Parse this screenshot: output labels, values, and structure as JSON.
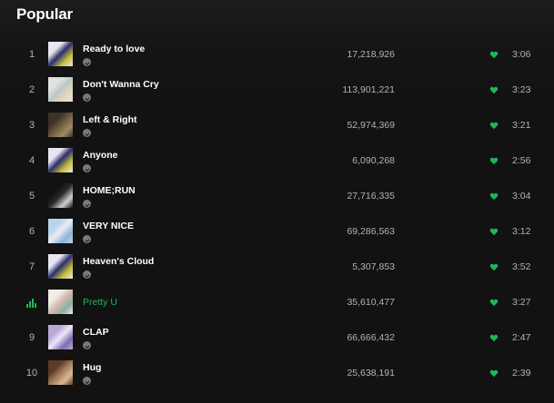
{
  "section": {
    "title": "Popular"
  },
  "colors": {
    "accent": "#1db954",
    "muted": "#b3b3b3",
    "background": "#121212"
  },
  "tracks": [
    {
      "num": "1",
      "title": "Ready to love",
      "plays": "17,218,926",
      "duration": "3:06",
      "playing": false,
      "art": [
        "#e9e6f0",
        "#2b2f6b",
        "#c9c040"
      ]
    },
    {
      "num": "2",
      "title": "Don't Wanna Cry",
      "plays": "113,901,221",
      "duration": "3:23",
      "playing": false,
      "art": [
        "#dfe2e4",
        "#b9c8c6",
        "#e6d7b8"
      ]
    },
    {
      "num": "3",
      "title": "Left & Right",
      "plays": "52,974,369",
      "duration": "3:21",
      "playing": false,
      "art": [
        "#3c3226",
        "#6b5a40",
        "#a08a60"
      ]
    },
    {
      "num": "4",
      "title": "Anyone",
      "plays": "6,090,268",
      "duration": "2:56",
      "playing": false,
      "art": [
        "#e9e6f0",
        "#2b2f6b",
        "#c9c040"
      ]
    },
    {
      "num": "5",
      "title": "HOME;RUN",
      "plays": "27,716,335",
      "duration": "3:04",
      "playing": false,
      "art": [
        "#111111",
        "#2a2a2a",
        "#d0d0d0"
      ]
    },
    {
      "num": "6",
      "title": "VERY NICE",
      "plays": "69,286,563",
      "duration": "3:12",
      "playing": false,
      "art": [
        "#b8d3ea",
        "#e9eef4",
        "#8fb2d6"
      ]
    },
    {
      "num": "7",
      "title": "Heaven's Cloud",
      "plays": "5,307,853",
      "duration": "3:52",
      "playing": false,
      "art": [
        "#e9e6f0",
        "#2b2f6b",
        "#c9c040"
      ]
    },
    {
      "num": "",
      "title": "Pretty U",
      "plays": "35,610,477",
      "duration": "3:27",
      "playing": true,
      "art": [
        "#f0ece6",
        "#d6b9b0",
        "#8fb0a0"
      ]
    },
    {
      "num": "9",
      "title": "CLAP",
      "plays": "66,666,432",
      "duration": "2:47",
      "playing": false,
      "art": [
        "#b9a8d8",
        "#efe6f6",
        "#7d6db0"
      ]
    },
    {
      "num": "10",
      "title": "Hug",
      "plays": "25,638,191",
      "duration": "2:39",
      "playing": false,
      "art": [
        "#5a3a28",
        "#a07858",
        "#d8b898"
      ]
    }
  ]
}
